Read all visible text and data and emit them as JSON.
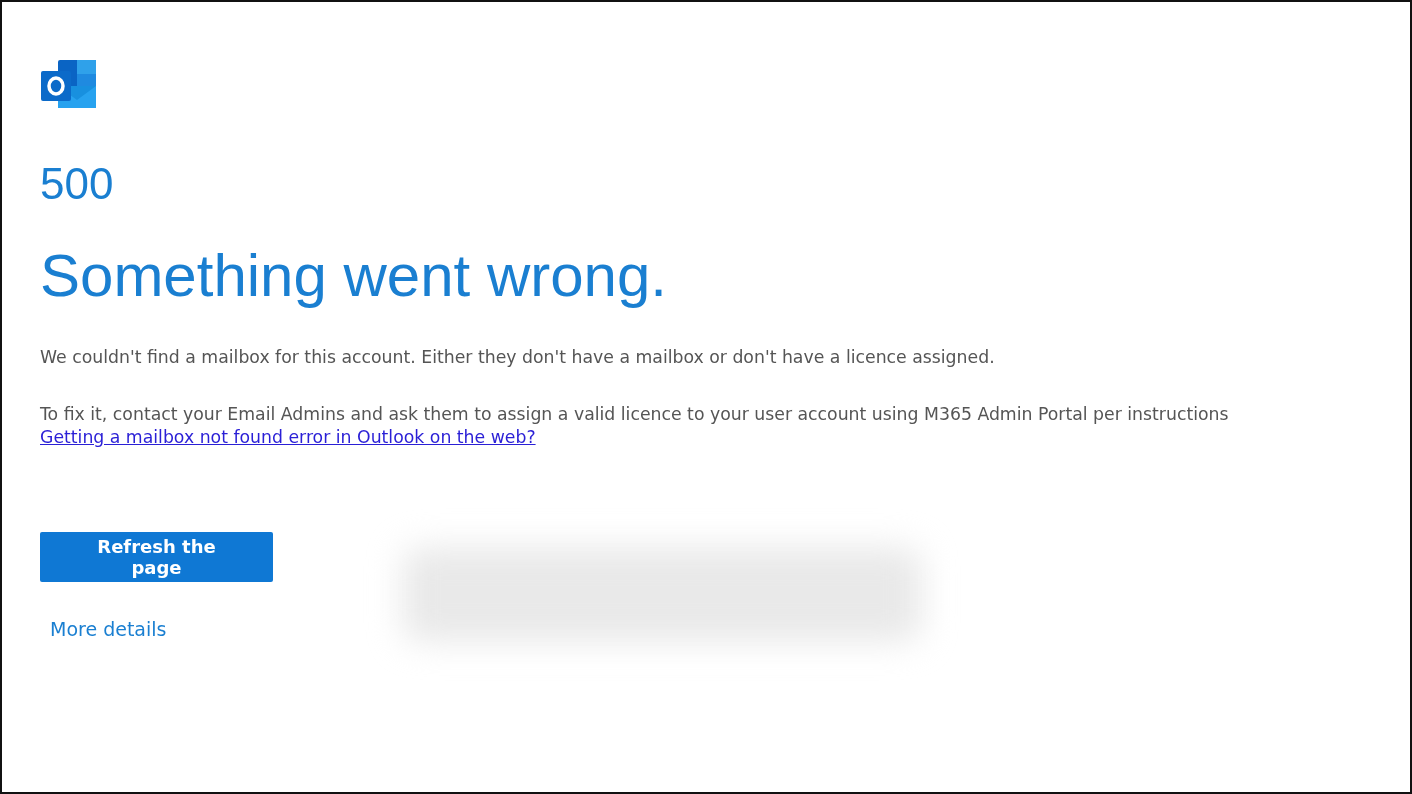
{
  "code": "500",
  "title": "Something went wrong.",
  "message": "We couldn't find a mailbox for this account. Either they don't have a mailbox or don't have a licence assigned.",
  "instructions": "To fix it, contact your Email Admins and ask them to assign a valid licence to your user account using M365 Admin Portal per instructions",
  "help_link": "Getting a mailbox not found error in Outlook on the web?",
  "refresh_button": "Refresh the page",
  "details_link": "More details"
}
